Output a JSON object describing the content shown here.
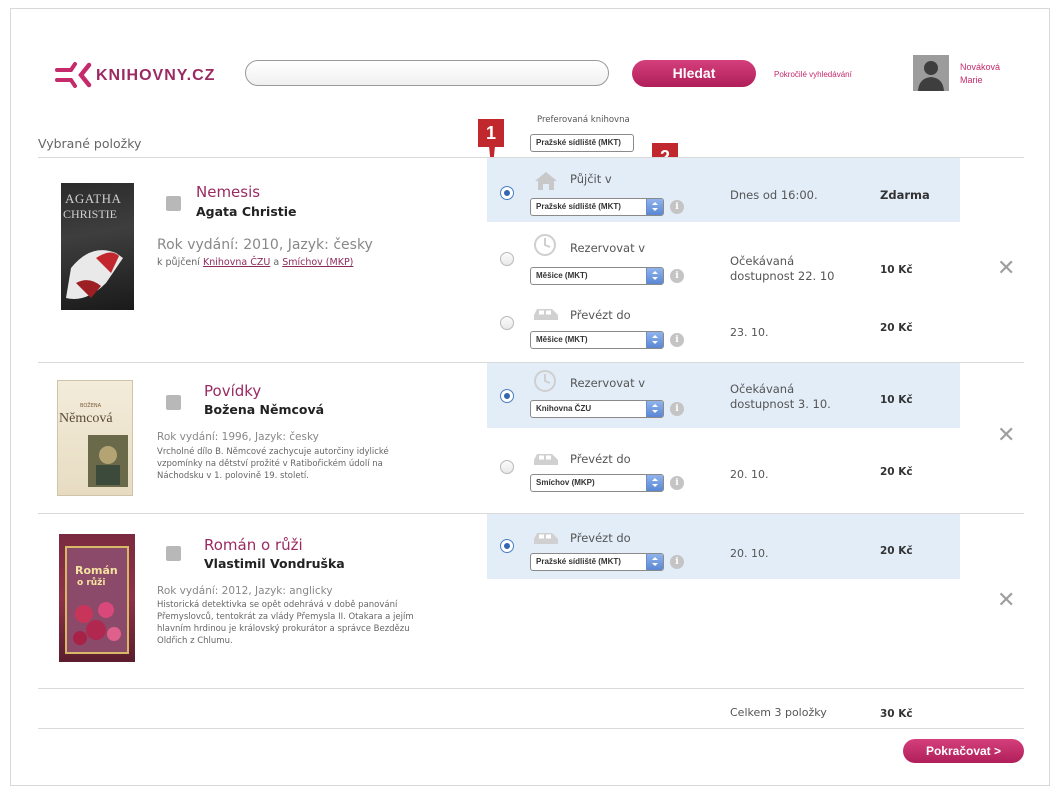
{
  "header": {
    "logo_text": "KNIHOVNY.CZ",
    "search_placeholder": "",
    "search_button": "Hledat",
    "advanced_search": "Pokročilé vyhledávání",
    "user_surname": "Nováková",
    "user_firstname": "Marie"
  },
  "page": {
    "section_title": "Vybrané položky",
    "preferred_label": "Preferovaná knihovna",
    "preferred_value": "Pražské sídliště (MKT)"
  },
  "markers": [
    "1",
    "2"
  ],
  "items": [
    {
      "title": "Nemesis",
      "author": "Agata Christie",
      "meta": "Rok vydání: 2010, Jazyk: česky",
      "borrow_prefix": "k půjčení",
      "borrow_link1": "Knihovna ČZU",
      "borrow_and": "a",
      "borrow_link2": "Smíchov (MKP)",
      "cover_top": "AGATHA",
      "cover_bottom": "CHRISTIE",
      "options": [
        {
          "action": "Půjčit v",
          "icon": "house-icon",
          "library": "Pražské sídliště (MKT)",
          "when": "Dnes od 16:00.",
          "when2": "",
          "price": "Zdarma",
          "selected": true
        },
        {
          "action": "Rezervovat v",
          "icon": "clock-icon",
          "library": "Měšice (MKT)",
          "when": "Očekávaná",
          "when2": "dostupnost 22. 10",
          "price": "10 Kč",
          "selected": false
        },
        {
          "action": "Převézt do",
          "icon": "car-icon",
          "library": "Měšice (MKT)",
          "when": "23. 10.",
          "when2": "",
          "price": "20 Kč",
          "selected": false
        }
      ]
    },
    {
      "title": "Povídky",
      "author": "Božena Němcová",
      "meta": "Rok vydání: 1996, Jazyk: česky",
      "desc": [
        "Vrcholné dílo B. Němcové zachycuje autorčiny idylické",
        "vzpomínky na dětství prožité v Ratibořickém údolí na",
        "Náchodsku v 1. polovině 19. století."
      ],
      "cover_top": "BOŽENA",
      "cover_bottom": "Němcová",
      "options": [
        {
          "action": "Rezervovat v",
          "icon": "clock-icon",
          "library": "Knihovna ČZU",
          "when": "Očekávaná",
          "when2": "dostupnost 3. 10.",
          "price": "10 Kč",
          "selected": true
        },
        {
          "action": "Převézt do",
          "icon": "car-icon",
          "library": "Smíchov (MKP)",
          "when": "20. 10.",
          "when2": "",
          "price": "20 Kč",
          "selected": false
        }
      ]
    },
    {
      "title": "Román o růži",
      "author": "Vlastimil Vondruška",
      "meta": "Rok vydání: 2012, Jazyk: anglicky",
      "desc": [
        "Historická detektivka se opět odehrává v době panování",
        "Přemyslovců, tentokrát za vlády Přemysla II. Otakara a jejím",
        "hlavním hrdinou je královský prokurátor a správce Bezdězu",
        "Oldřich z Chlumu."
      ],
      "cover_top": "Román",
      "cover_bottom": "o růži",
      "options": [
        {
          "action": "Převézt do",
          "icon": "car-icon",
          "library": "Pražské sídliště (MKT)",
          "when": "20. 10.",
          "when2": "",
          "price": "20 Kč",
          "selected": true
        }
      ]
    }
  ],
  "summary": {
    "total_label": "Celkem 3 položky",
    "total_price": "30 Kč",
    "continue": "Pokračovat >"
  },
  "colors": {
    "accent": "#c52a6a",
    "highlight": "#e2edf8",
    "marker": "#c0282d"
  }
}
